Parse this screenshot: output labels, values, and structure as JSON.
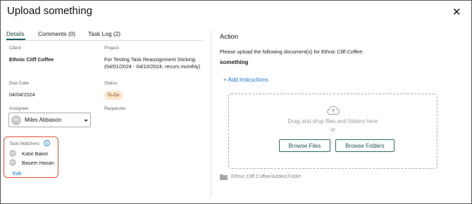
{
  "dialog": {
    "title": "Upload something",
    "close_icon": "close-icon"
  },
  "tabs": [
    {
      "label": "Details",
      "active": true
    },
    {
      "label": "Comments (0)",
      "active": false
    },
    {
      "label": "Task Log (2)",
      "active": false
    }
  ],
  "details": {
    "client_label": "Client",
    "client_value": "Ethnic Cliff Coffee",
    "project_label": "Project",
    "project_value": "For Testing Task Reassignment Sticking (04/01/2024 - 04/10/2024, recurs monthly)",
    "due_date_label": "Due Date",
    "due_date_value": "04/04/2024",
    "status_label": "Status",
    "status_value": "To-Do",
    "status_color": "#fbe7cc",
    "assignee_label": "Assignee",
    "assignee": {
      "initials": "MA",
      "name": "Miles Abbason"
    },
    "requester_label": "Requester",
    "watchers_label": "Task Watchers",
    "watchers": [
      {
        "initials": "KB",
        "name": "Katie Baker"
      },
      {
        "initials": "BH",
        "name": "Basem Hasan"
      }
    ],
    "edit_label": "Edit"
  },
  "action": {
    "title": "Action",
    "instructions": "Please upload the following document(s) for Ethnic Cliff Coffee:",
    "document_name": "something",
    "add_instructions_label": "+ Add Instructions",
    "dropzone": {
      "icon": "cloud-upload-icon",
      "text": "Drag and drop files and folders here",
      "or_text": "or",
      "browse_files_label": "Browse Files",
      "browse_folders_label": "Browse Folders"
    },
    "folder": {
      "icon": "folder-icon",
      "path": "Ethnic Cliff Coffee/Added Folder"
    }
  },
  "colors": {
    "accent": "#1f5f5f",
    "link": "#1a73c7",
    "highlight_border": "#e0502f"
  }
}
